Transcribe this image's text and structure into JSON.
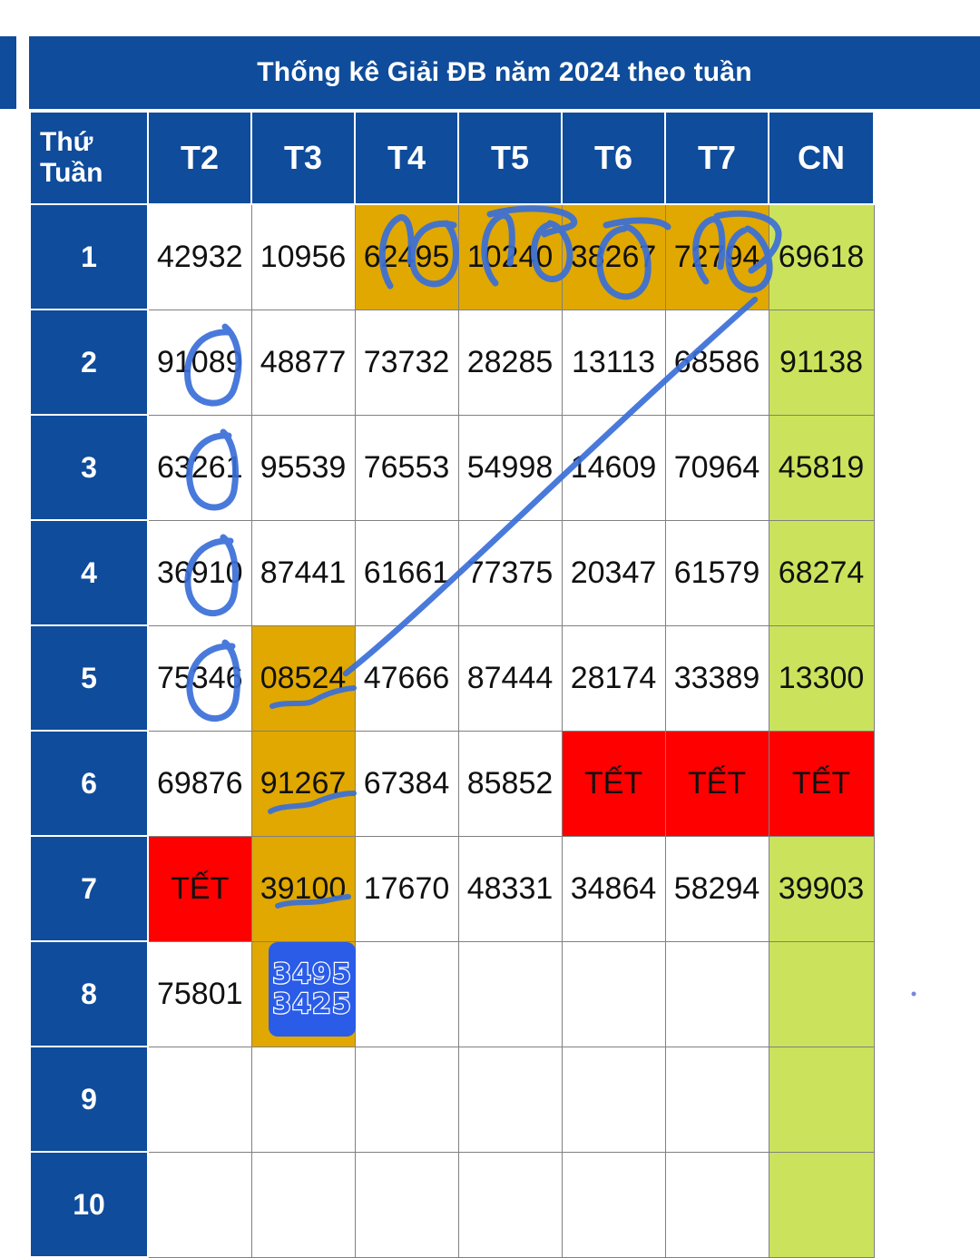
{
  "colors": {
    "header_blue": "#0f4c9b",
    "gold": "#e0a800",
    "green": "#cbe35c",
    "red": "#ff0000",
    "ink_blue": "#3a6fd8",
    "note_blue": "#2a5ce8"
  },
  "title": "Thống kê Giải ĐB năm 2024 theo tuần",
  "table": {
    "corner_label_line1": "Thứ",
    "corner_label_line2": "Tuần",
    "columns": [
      "T2",
      "T3",
      "T4",
      "T5",
      "T6",
      "T7",
      "CN"
    ],
    "rows": [
      {
        "label": "1",
        "cells": [
          {
            "value": "42932",
            "fill": "white"
          },
          {
            "value": "10956",
            "fill": "white"
          },
          {
            "value": "62495",
            "fill": "gold"
          },
          {
            "value": "10240",
            "fill": "gold"
          },
          {
            "value": "38267",
            "fill": "gold"
          },
          {
            "value": "72794",
            "fill": "gold"
          },
          {
            "value": "69618",
            "fill": "green"
          }
        ]
      },
      {
        "label": "2",
        "cells": [
          {
            "value": "91089",
            "fill": "white"
          },
          {
            "value": "48877",
            "fill": "white"
          },
          {
            "value": "73732",
            "fill": "white"
          },
          {
            "value": "28285",
            "fill": "white"
          },
          {
            "value": "13113",
            "fill": "white"
          },
          {
            "value": "68586",
            "fill": "white"
          },
          {
            "value": "91138",
            "fill": "green"
          }
        ]
      },
      {
        "label": "3",
        "cells": [
          {
            "value": "63261",
            "fill": "white"
          },
          {
            "value": "95539",
            "fill": "white"
          },
          {
            "value": "76553",
            "fill": "white"
          },
          {
            "value": "54998",
            "fill": "white"
          },
          {
            "value": "14609",
            "fill": "white"
          },
          {
            "value": "70964",
            "fill": "white"
          },
          {
            "value": "45819",
            "fill": "green"
          }
        ]
      },
      {
        "label": "4",
        "cells": [
          {
            "value": "36910",
            "fill": "white"
          },
          {
            "value": "87441",
            "fill": "white"
          },
          {
            "value": "61661",
            "fill": "white"
          },
          {
            "value": "77375",
            "fill": "white"
          },
          {
            "value": "20347",
            "fill": "white"
          },
          {
            "value": "61579",
            "fill": "white"
          },
          {
            "value": "68274",
            "fill": "green"
          }
        ]
      },
      {
        "label": "5",
        "cells": [
          {
            "value": "75346",
            "fill": "white"
          },
          {
            "value": "08524",
            "fill": "gold"
          },
          {
            "value": "47666",
            "fill": "white"
          },
          {
            "value": "87444",
            "fill": "white"
          },
          {
            "value": "28174",
            "fill": "white"
          },
          {
            "value": "33389",
            "fill": "white"
          },
          {
            "value": "13300",
            "fill": "green"
          }
        ]
      },
      {
        "label": "6",
        "cells": [
          {
            "value": "69876",
            "fill": "white"
          },
          {
            "value": "91267",
            "fill": "gold"
          },
          {
            "value": "67384",
            "fill": "white"
          },
          {
            "value": "85852",
            "fill": "white"
          },
          {
            "value": "TẾT",
            "fill": "red"
          },
          {
            "value": "TẾT",
            "fill": "red"
          },
          {
            "value": "TẾT",
            "fill": "red"
          }
        ]
      },
      {
        "label": "7",
        "cells": [
          {
            "value": "TẾT",
            "fill": "red"
          },
          {
            "value": "39100",
            "fill": "gold"
          },
          {
            "value": "17670",
            "fill": "white"
          },
          {
            "value": "48331",
            "fill": "white"
          },
          {
            "value": "34864",
            "fill": "white"
          },
          {
            "value": "58294",
            "fill": "white"
          },
          {
            "value": "39903",
            "fill": "green"
          }
        ]
      },
      {
        "label": "8",
        "cells": [
          {
            "value": "75801",
            "fill": "white"
          },
          {
            "value": "",
            "fill": "gold"
          },
          {
            "value": "",
            "fill": "white"
          },
          {
            "value": "",
            "fill": "white"
          },
          {
            "value": "",
            "fill": "white"
          },
          {
            "value": "",
            "fill": "white"
          },
          {
            "value": "",
            "fill": "green"
          }
        ]
      },
      {
        "label": "9",
        "cells": [
          {
            "value": "",
            "fill": "white"
          },
          {
            "value": "",
            "fill": "white"
          },
          {
            "value": "",
            "fill": "white"
          },
          {
            "value": "",
            "fill": "white"
          },
          {
            "value": "",
            "fill": "white"
          },
          {
            "value": "",
            "fill": "white"
          },
          {
            "value": "",
            "fill": "green"
          }
        ]
      },
      {
        "label": "10",
        "cells": [
          {
            "value": "",
            "fill": "white"
          },
          {
            "value": "",
            "fill": "white"
          },
          {
            "value": "",
            "fill": "white"
          },
          {
            "value": "",
            "fill": "white"
          },
          {
            "value": "",
            "fill": "white"
          },
          {
            "value": "",
            "fill": "white"
          },
          {
            "value": "",
            "fill": "green"
          }
        ]
      }
    ]
  },
  "annotations": {
    "note_box": {
      "line1": "3495",
      "line2": "3425"
    }
  }
}
